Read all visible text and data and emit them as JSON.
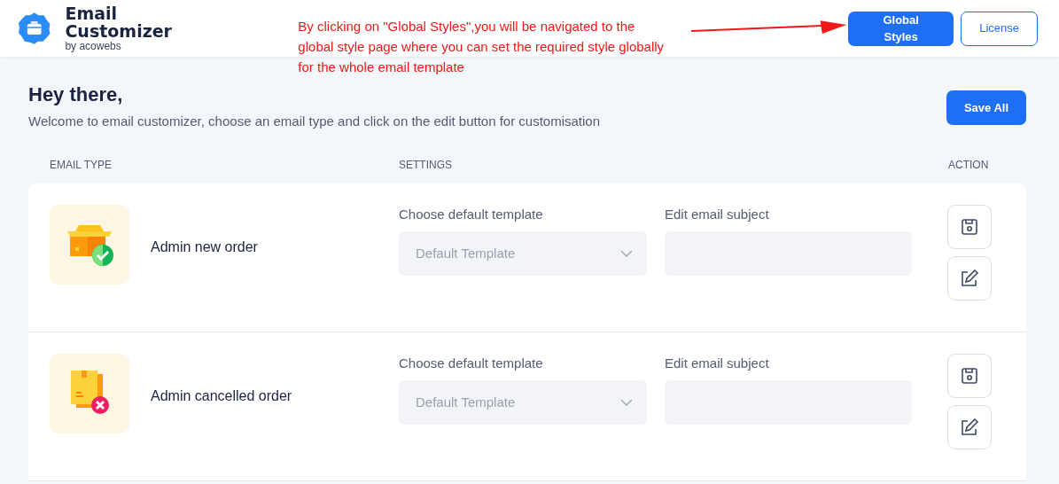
{
  "app": {
    "title": "Email Customizer",
    "subtitle": "by acowebs"
  },
  "annotation": {
    "text": "By clicking on \"Global Styles\",you will be navigated to the global style page  where you can set the required style globally for the whole email template"
  },
  "header_buttons": [
    {
      "label": "Global Styles",
      "kind": "primary"
    },
    {
      "label": "License",
      "kind": "outline"
    }
  ],
  "intro": {
    "heading": "Hey there,",
    "text": "Welcome to email customizer, choose an email type and click on the edit button for customisation"
  },
  "save_all": "Save All",
  "table": {
    "columns": [
      "EMAIL TYPE",
      "SETTINGS",
      "ACTION"
    ],
    "rows": [
      {
        "name": "Admin new order",
        "kind": "new",
        "template_label": "Choose default template",
        "template_value": "Default Template",
        "subject_label": "Edit email subject"
      },
      {
        "name": "Admin cancelled order",
        "kind": "cancelled",
        "template_label": "Choose default template",
        "template_value": "Default Template",
        "subject_label": "Edit email subject"
      }
    ]
  }
}
